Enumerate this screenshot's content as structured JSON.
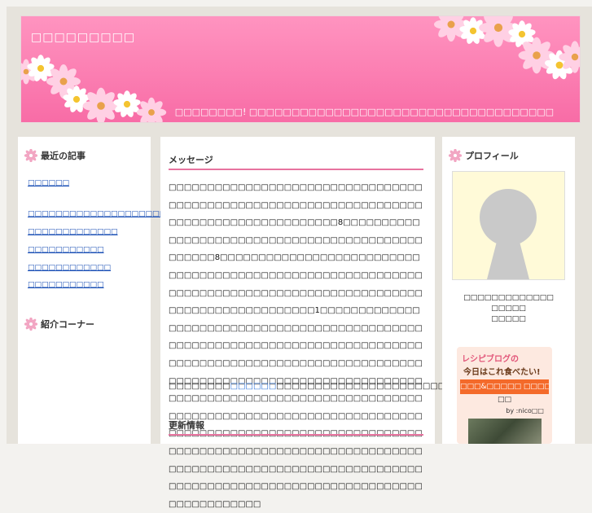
{
  "header": {
    "site_title": "□□□□□□□□□",
    "tagline": "□□□□□□□□! □□□□□□□□□□□□□□□□□□□□□□□□□□□□□□□□□□□□"
  },
  "left_sidebar": {
    "recent_heading": "最近の記事",
    "recent_items": [
      "□□□□□□",
      "□□□□□□□□□□□□□□□□□□□□□□",
      "□□□□□□□□□□□□□",
      "□□□□□□□□□□□",
      "□□□□□□□□□□□□",
      "□□□□□□□□□□□"
    ],
    "intro_heading": "紹介コーナー"
  },
  "main": {
    "message_heading": "メッセージ",
    "message_paragraph": "□□□□□□□□□□□□□□□□□□□□□□□□□□□□□□□□□□□□□□□□□□□□□□□□□□□□□□□□□□□□□□□□□□□□□□□□□□□□□□□□□□□□□□□□8□□□□□□□□□□□□□□□□□□□□□□□□□□□□□□□□□□□□□□□□□□□□□□□□□8□□□□□□□□□□□□□□□□□□□□□□□□□□□□□□□□□□□□□□□□□□□□□□□□□□□□□□□□□□□□□□□□□□□□□□□□□□□□□□□□□□□□□□□□□□□□□□□□□□□□□□□□□□□□□□□1□□□□□□□□□□□□□□□□□□□□□□□□□□□□□□□□□□□□□□□□□□□□□□□□□□□□□□□□□□□□□□□□□□□□□□□□□□□□□□□□□□□□□□□□□□□□□□□□□□□□□□□□□□□□□□□□□□□□□□□□□□□□□□□□□□□□□□□□□□□□□□□□□□□□□□□□□□□□□□□□□□□□□□□□□□□□□□□□□□□□□□□□□□□□□□□□□□□□□□□□□□□□□□□□□□□□□□□□□□□□□□□□□□□□□□□□□□□□□□□□□□□□□□□□□□□□□□□□□□□□□□□□□□□□□□□□□□□□□□□□□□□□□□□□□□□□□□□□□□□□□□□□□□□□□□□□□□□□□□□□□□□□□□□□□□□□□□□□□□□□□□□□□□□□□□□□□□□",
    "invite_prefix": "□□□□□□□□",
    "invite_link": "□□□□□□",
    "invite_suffix": "□□□□□□□□□□□□□□□□□□□□□□□□□□□□□□□□□□□",
    "updates_heading": "更新情報"
  },
  "right_sidebar": {
    "profile_heading": "プロフィール",
    "profile_lines": [
      "□□□□□□□□□□□□□",
      "□□□□□",
      "□□□□□"
    ],
    "recipe_banner": {
      "logo": "レシピブログの",
      "subtitle": "今日はこれ食べたい!",
      "title_line1": "□□□&□□□□□ □□□□□□□□□□",
      "title_line2": "□□",
      "author": "by :nico□□"
    }
  },
  "colors": {
    "accent_pink": "#e7739f",
    "header_pink": "#f86ca6",
    "link_blue": "#1a4fb5"
  }
}
